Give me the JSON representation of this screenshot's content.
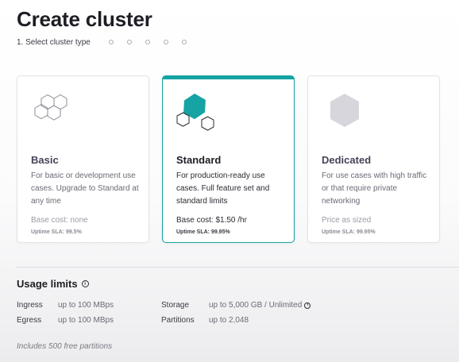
{
  "page": {
    "title": "Create cluster"
  },
  "stepper": {
    "current_label": "1. Select cluster type",
    "total_steps": 5,
    "current_step": 1
  },
  "cards": [
    {
      "name": "Basic",
      "description": "For basic or development use cases. Upgrade to Standard at any time",
      "cost": "Base cost: none",
      "sla": "Uptime SLA: 99.5%",
      "selected": false,
      "icon": "hexagon-outline-cluster-icon"
    },
    {
      "name": "Standard",
      "description": "For production-ready use cases. Full feature set and standard limits",
      "cost": "Base cost: $1.50 /hr",
      "sla": "Uptime SLA: 99.95%",
      "selected": true,
      "icon": "hexagon-teal-cluster-icon"
    },
    {
      "name": "Dedicated",
      "description": "For use cases with high traffic or that require private networking",
      "cost": "Price as sized",
      "sla": "Uptime SLA: 99.95%",
      "selected": false,
      "icon": "hexagon-solid-icon"
    }
  ],
  "usage": {
    "title": "Usage limits",
    "ingress_label": "Ingress",
    "ingress_value": "up to 100 MBps",
    "egress_label": "Egress",
    "egress_value": "up to 100 MBps",
    "storage_label": "Storage",
    "storage_value": "up to 5,000 GB / Unlimited",
    "partitions_label": "Partitions",
    "partitions_value": "up to 2,048",
    "note": "Includes 500 free partitions"
  },
  "colors": {
    "accent": "#15a3a3",
    "hexagon_gray": "#d6d6dc",
    "outline": "#8d8d97"
  }
}
